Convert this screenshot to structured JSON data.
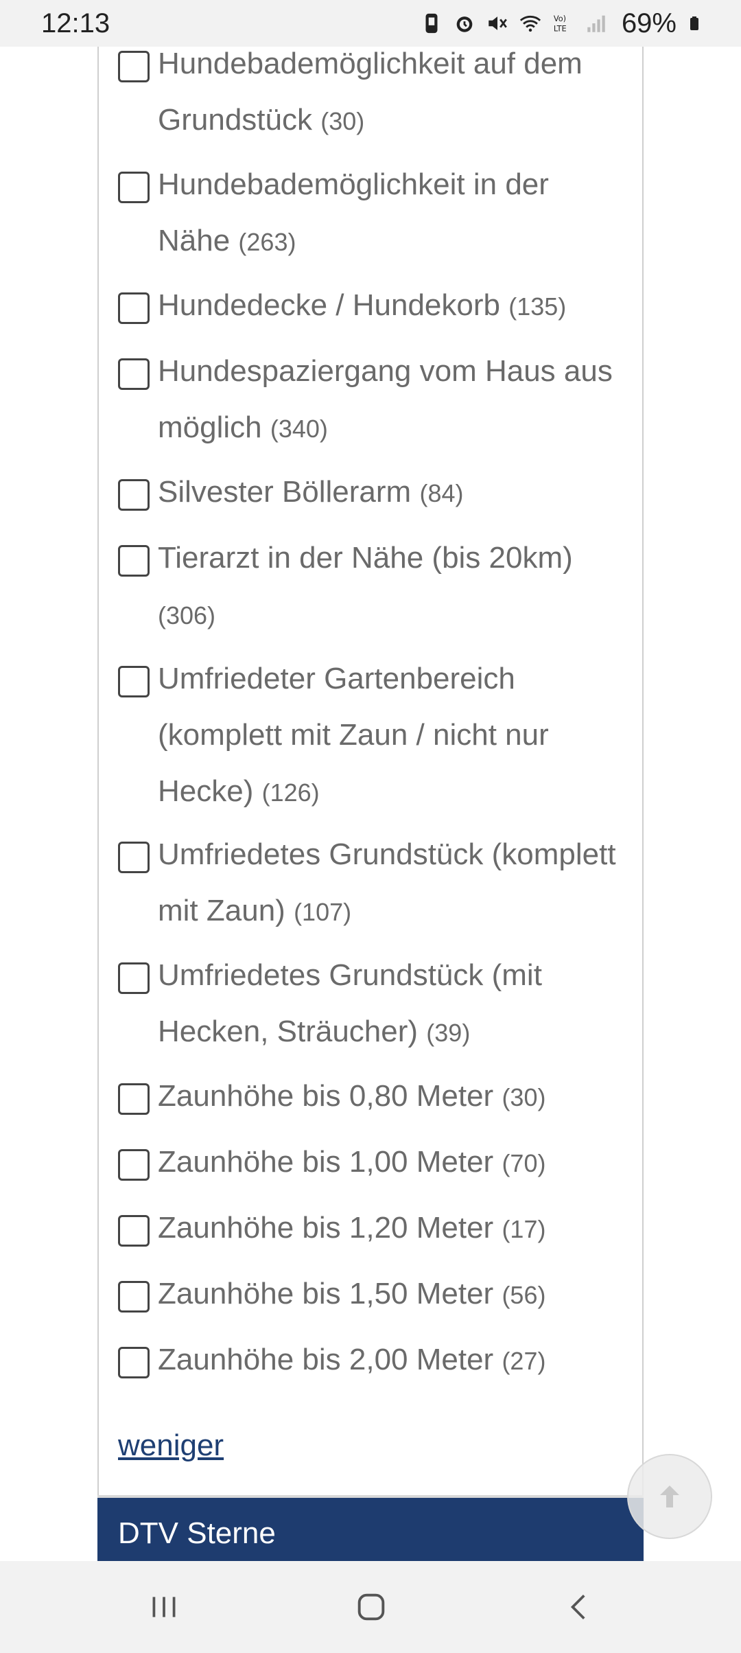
{
  "status_bar": {
    "time": "12:13",
    "battery_percent": "69%"
  },
  "filters": [
    {
      "label": "Hundebademöglichkeit auf dem Grundstück",
      "count": "(30)",
      "checked": false
    },
    {
      "label": "Hundebademöglichkeit in der Nähe",
      "count": "(263)",
      "checked": false
    },
    {
      "label": "Hundedecke / Hundekorb",
      "count": "(135)",
      "checked": false
    },
    {
      "label": "Hundespaziergang vom Haus aus möglich",
      "count": "(340)",
      "checked": false
    },
    {
      "label": "Silvester Böllerarm",
      "count": "(84)",
      "checked": false
    },
    {
      "label": "Tierarzt in der Nähe (bis 20km)",
      "count": "(306)",
      "checked": false
    },
    {
      "label": "Umfriedeter Gartenbereich (komplett mit Zaun / nicht nur Hecke)",
      "count": "(126)",
      "checked": false
    },
    {
      "label": "Umfriedetes Grundstück (komplett mit Zaun)",
      "count": "(107)",
      "checked": false
    },
    {
      "label": "Umfriedetes Grundstück (mit Hecken, Sträucher)",
      "count": "(39)",
      "checked": false
    },
    {
      "label": "Zaunhöhe bis 0,80 Meter",
      "count": "(30)",
      "checked": false
    },
    {
      "label": "Zaunhöhe bis 1,00 Meter",
      "count": "(70)",
      "checked": false
    },
    {
      "label": "Zaunhöhe bis 1,20 Meter",
      "count": "(17)",
      "checked": false
    },
    {
      "label": "Zaunhöhe bis 1,50 Meter",
      "count": "(56)",
      "checked": false
    },
    {
      "label": "Zaunhöhe bis 2,00 Meter",
      "count": "(27)",
      "checked": false
    }
  ],
  "less_link": "weniger",
  "next_section_title": "DTV Sterne",
  "icons": {
    "back_to_top": "arrow-up-icon",
    "nav_recents": "recents-icon",
    "nav_home": "home-icon",
    "nav_back": "back-icon"
  },
  "colors": {
    "accent_dark_blue": "#1e3c6f",
    "link_blue": "#1e3f73",
    "text_gray": "#6a6a6a"
  }
}
